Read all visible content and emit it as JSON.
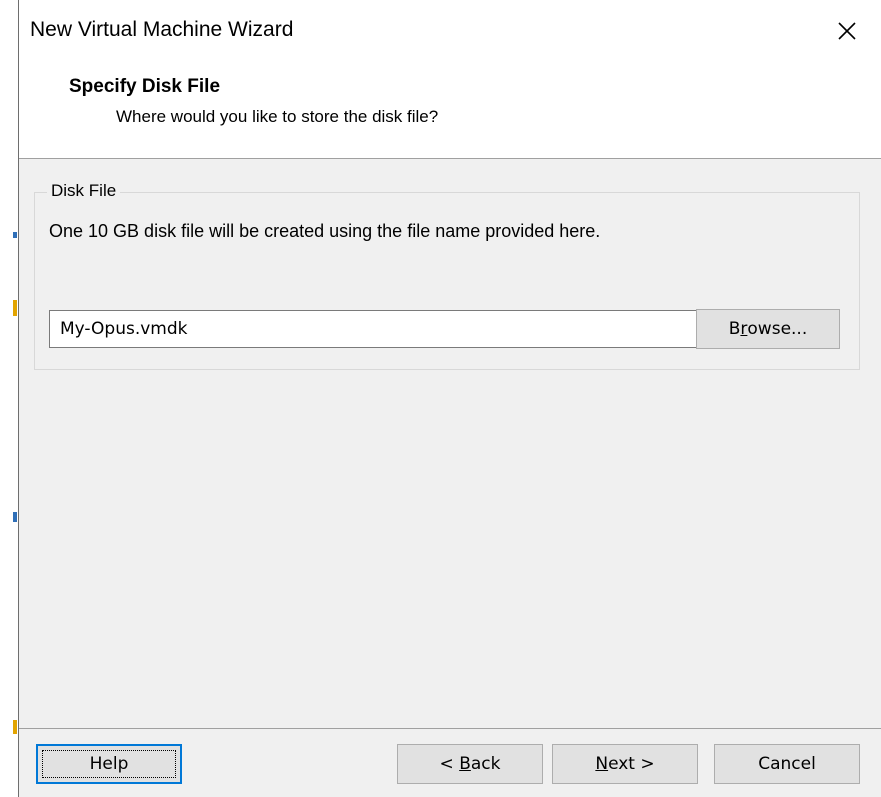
{
  "window": {
    "title": "New Virtual Machine Wizard",
    "close_glyph": "✕"
  },
  "header": {
    "title": "Specify Disk File",
    "subtitle": "Where would you like to store the disk file?"
  },
  "disk_file": {
    "group_label": "Disk File",
    "description": "One 10 GB disk file will be created using the file name provided here.",
    "filename_value": "My-Opus.vmdk",
    "browse_prefix": "B",
    "browse_mnemonic": "r",
    "browse_suffix": "owse..."
  },
  "footer": {
    "help_label": "Help",
    "back_prefix": "< ",
    "back_mnemonic": "B",
    "back_suffix": "ack",
    "next_mnemonic": "N",
    "next_suffix": "ext >",
    "cancel_label": "Cancel"
  },
  "colors": {
    "dialog_bg": "#f0f0f0",
    "focus_border": "#0078d7",
    "button_bg": "#e1e1e1"
  }
}
